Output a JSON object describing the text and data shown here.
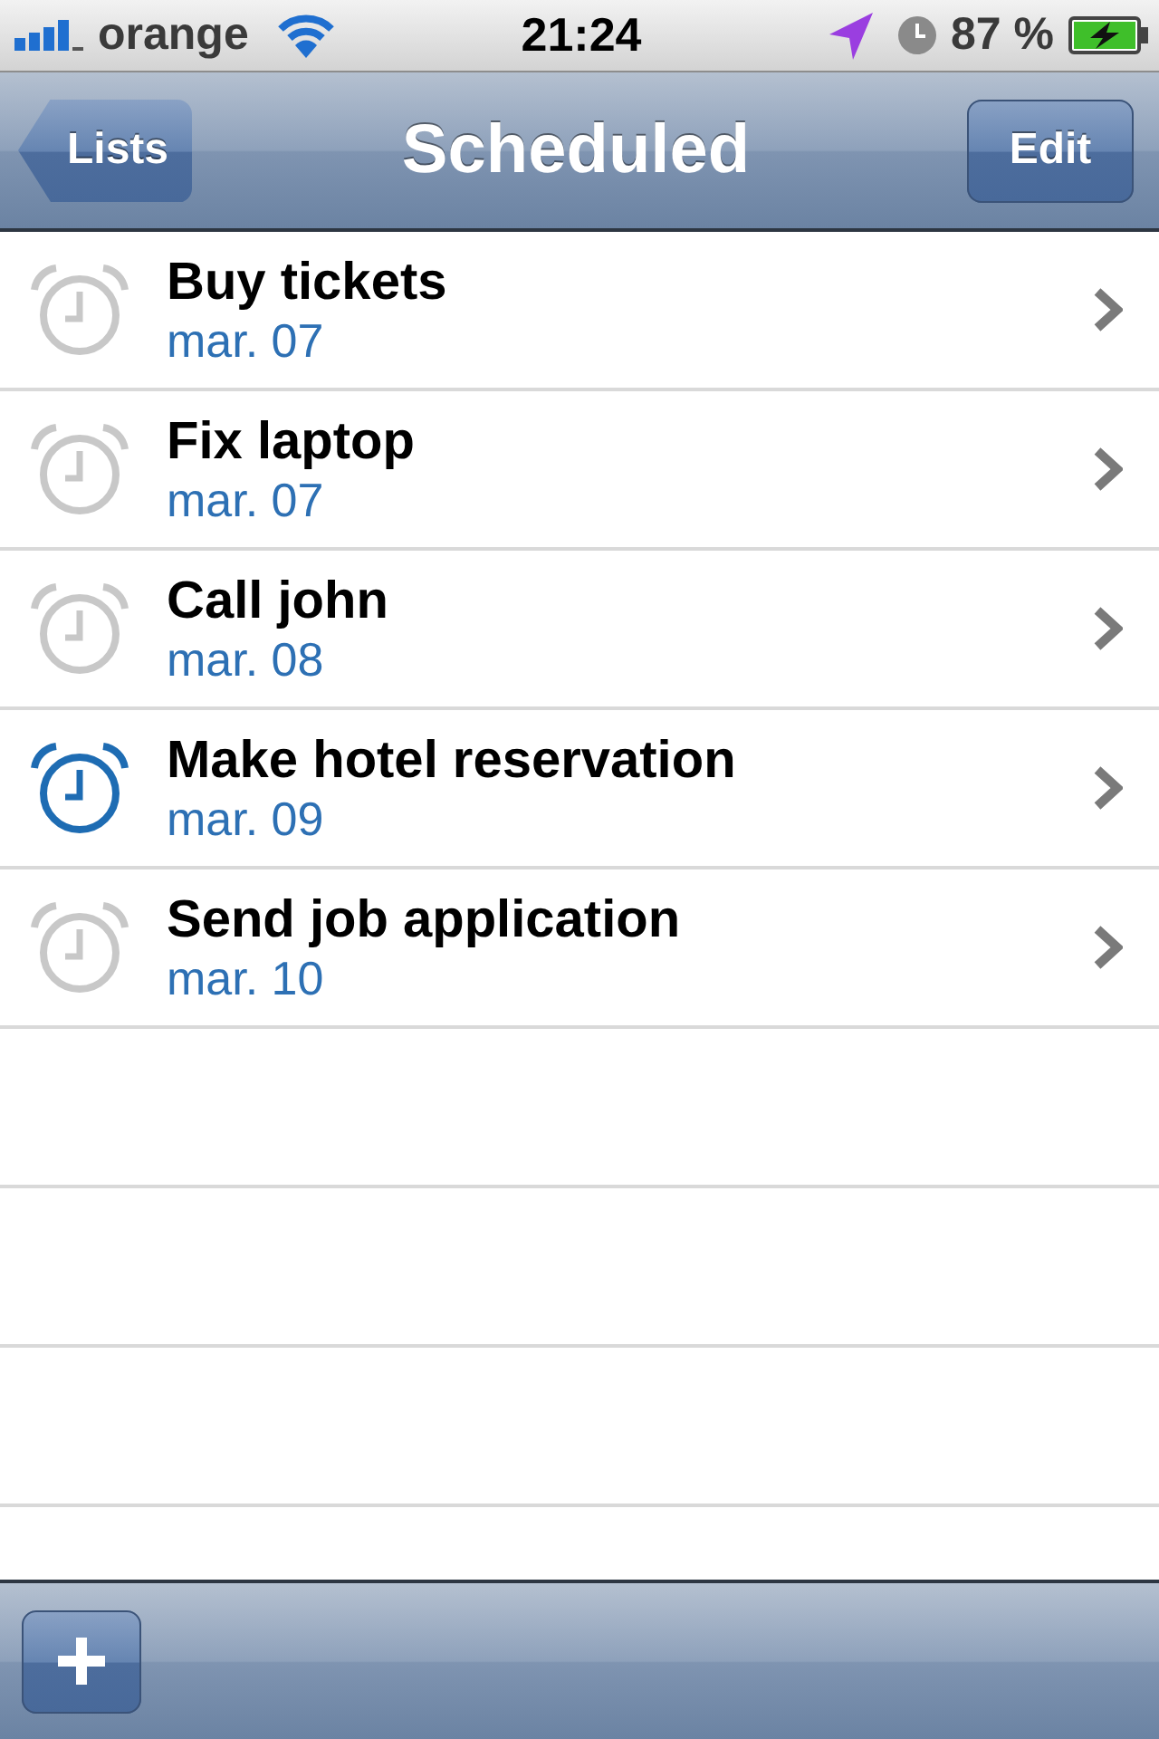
{
  "status_bar": {
    "carrier": "orange",
    "time": "21:24",
    "battery": "87 %"
  },
  "nav_bar": {
    "back_button": "Lists",
    "title": "Scheduled",
    "edit_button": "Edit"
  },
  "tasks": [
    {
      "title": "Buy tickets",
      "date": "mar. 07",
      "alarm_active": false
    },
    {
      "title": "Fix laptop",
      "date": "mar. 07",
      "alarm_active": false
    },
    {
      "title": "Call john",
      "date": "mar. 08",
      "alarm_active": false
    },
    {
      "title": "Make hotel reservation",
      "date": "mar. 09",
      "alarm_active": true
    },
    {
      "title": "Send job application",
      "date": "mar. 10",
      "alarm_active": false
    }
  ]
}
